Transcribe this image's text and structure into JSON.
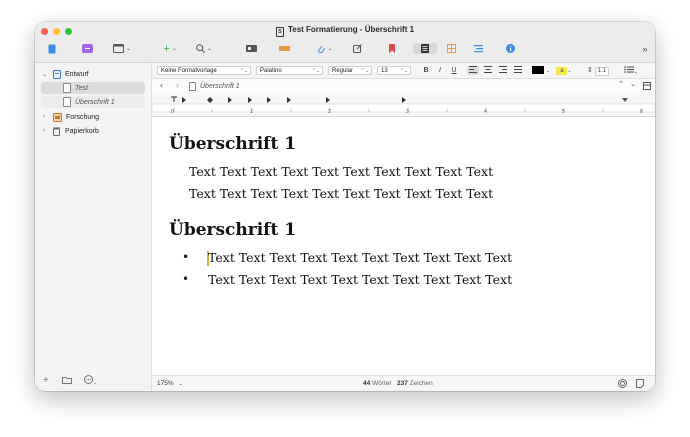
{
  "window": {
    "title": "Test Formatierung - Überschrift 1"
  },
  "toolbar": {
    "icons": [
      "binder-icon",
      "compose-icon",
      "layout-icon",
      "add-icon",
      "search-icon",
      "inspector-icon",
      "ruler-icon",
      "attach-icon",
      "edit-icon",
      "bookmark-icon",
      "document-icon",
      "corkboard-icon",
      "outline-icon",
      "info-icon",
      "more-icon"
    ]
  },
  "sidebar": {
    "items": [
      {
        "label": "Entwurf"
      },
      {
        "label": "Test"
      },
      {
        "label": "Überschrift 1"
      },
      {
        "label": "Forschung"
      },
      {
        "label": "Papierkorb"
      }
    ]
  },
  "format": {
    "style": "Keine Formatvorlage",
    "font": "Palatino",
    "weight": "Regular",
    "size": "13",
    "bold": "B",
    "italic": "I",
    "underline": "U",
    "highlight": "a",
    "line_spacing": "1.1"
  },
  "navbar": {
    "breadcrumb": "Überschrift 1"
  },
  "ruler": {
    "numbers": [
      "0",
      "1",
      "2",
      "3",
      "4",
      "5",
      "6"
    ]
  },
  "document": {
    "heading1": "Überschrift 1",
    "para1_line1": "Text Text Text Text Text Text Text Text Text Text",
    "para1_line2": "Text Text Text Text Text Text Text Text Text Text",
    "heading2": "Überschrift 1",
    "bullet_char": "•",
    "bullet1": "Text Text Text Text Text Text Text Text Text Text",
    "bullet2": "Text Text Text Text Text Text Text Text Text Text"
  },
  "status": {
    "zoom": "175%",
    "words_count": "44",
    "words_label": "Wörter",
    "chars_count": "237",
    "chars_label": "Zeichen"
  },
  "colors": {
    "traffic_red": "#ff5f57",
    "traffic_yellow": "#febc2e",
    "traffic_green": "#28c840",
    "selection": "#dcdcdc",
    "cursor": "#e2a83c"
  }
}
